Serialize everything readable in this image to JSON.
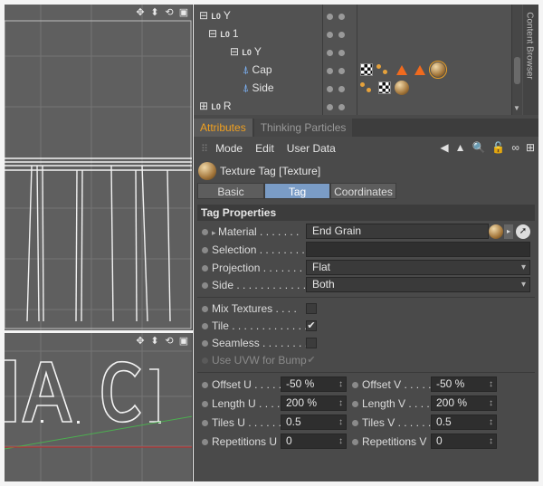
{
  "viewport": {
    "top_tools": [
      "✥",
      "⬍",
      "⟲",
      "▣"
    ],
    "bottom_tools": [
      "✥",
      "⬍",
      "⟲",
      "▣"
    ],
    "colors": {
      "bg": "#5f5f5f",
      "grid": "#747474",
      "lines": "#f2f2f2",
      "x_axis": "#c62828",
      "z_axis": "#4caf50"
    }
  },
  "object_manager": {
    "null_icon": "L0",
    "rows": [
      {
        "name": "Y",
        "type": "null"
      },
      {
        "name": "1",
        "type": "null"
      },
      {
        "name": "Y",
        "type": "null"
      },
      {
        "name": "Cap",
        "type": "cap"
      },
      {
        "name": "Side",
        "type": "cap"
      },
      {
        "name": "R",
        "type": "null"
      }
    ],
    "content_browser_label": "Content Browser"
  },
  "tabs": [
    {
      "label": "Attributes",
      "active": true
    },
    {
      "label": "Thinking Particles",
      "active": false
    }
  ],
  "toolbar": {
    "mode": "Mode",
    "edit": "Edit",
    "user_data": "User Data",
    "icons": [
      "◀",
      "▲",
      "🔍",
      "🔓",
      "∞",
      "⊞"
    ]
  },
  "header": {
    "title": "Texture Tag [Texture]"
  },
  "subtabs": [
    {
      "label": "Basic",
      "active": false
    },
    {
      "label": "Tag",
      "active": true
    },
    {
      "label": "Coordinates",
      "active": false
    }
  ],
  "section_title": "Tag Properties",
  "props": {
    "material_label": "Material . . . . . . .",
    "material_value": "End Grain",
    "selection_label": "Selection . . . . . . . .",
    "selection_value": "",
    "projection_label": "Projection . . . . . . .",
    "projection_value": "Flat",
    "side_label": "Side . . . . . . . . . . . .",
    "side_value": "Both",
    "mix_label": "Mix Textures . . . .",
    "mix_checked": "",
    "tile_label": "Tile . . . . . . . . . . . . .",
    "tile_checked": "✔",
    "seamless_label": "Seamless . . . . . . . .",
    "seamless_checked": "",
    "uvw_label": "Use UVW for Bump",
    "uvw_checked": "✔",
    "offset_u_label": "Offset U . . . . .",
    "offset_u": "-50 %",
    "offset_v_label": "Offset V . . . . .",
    "offset_v": "-50 %",
    "length_u_label": "Length U . . . . .",
    "length_u": "200 %",
    "length_v_label": "Length V . . . . .",
    "length_v": "200 %",
    "tiles_u_label": "Tiles U . . . . . .",
    "tiles_u": "0.5",
    "tiles_v_label": "Tiles V . . . . . .",
    "tiles_v": "0.5",
    "reps_u_label": "Repetitions U",
    "reps_u": "0",
    "reps_v_label": "Repetitions V",
    "reps_v": "0"
  },
  "accent_color": "#f0a020",
  "active_subtab_color": "#7a9cc6"
}
